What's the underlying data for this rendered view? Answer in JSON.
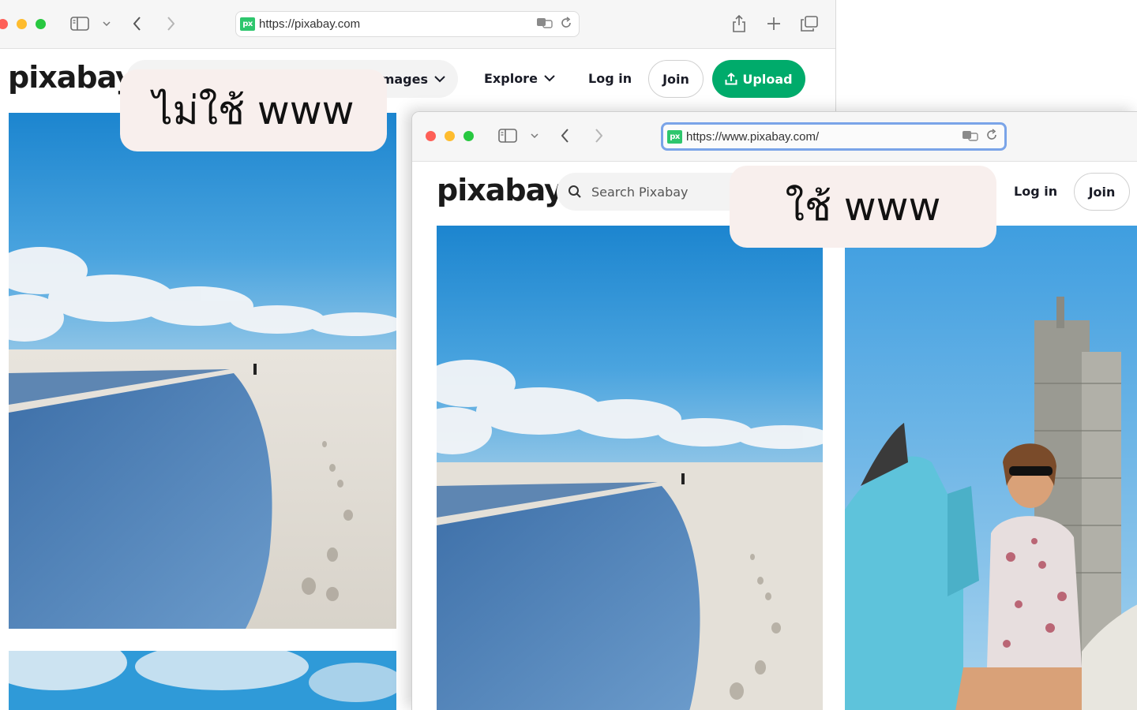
{
  "back_window": {
    "url": "https://pixabay.com",
    "logo": "pixabay",
    "nav": {
      "images_label": "Images",
      "explore_label": "Explore",
      "login_label": "Log in",
      "join_label": "Join",
      "upload_label": "Upload"
    },
    "callout": "ไม่ใช้ www"
  },
  "front_window": {
    "url": "https://www.pixabay.com/",
    "logo": "pixabay",
    "search_placeholder": "Search Pixabay",
    "nav": {
      "login_label": "Log in",
      "join_label": "Join"
    },
    "callout": "ใช้ www"
  },
  "colors": {
    "accent": "#00ab6b",
    "traffic_red": "#fe5f57",
    "traffic_yellow": "#febc2e",
    "traffic_green": "#28c840",
    "callout_bg": "#f8efed"
  },
  "icons": [
    "sidebar-icon",
    "chevron-down-icon",
    "back-arrow-icon",
    "forward-arrow-icon",
    "translate-icon",
    "reload-icon",
    "share-icon",
    "plus-icon",
    "tabs-icon",
    "upload-icon",
    "search-icon"
  ]
}
